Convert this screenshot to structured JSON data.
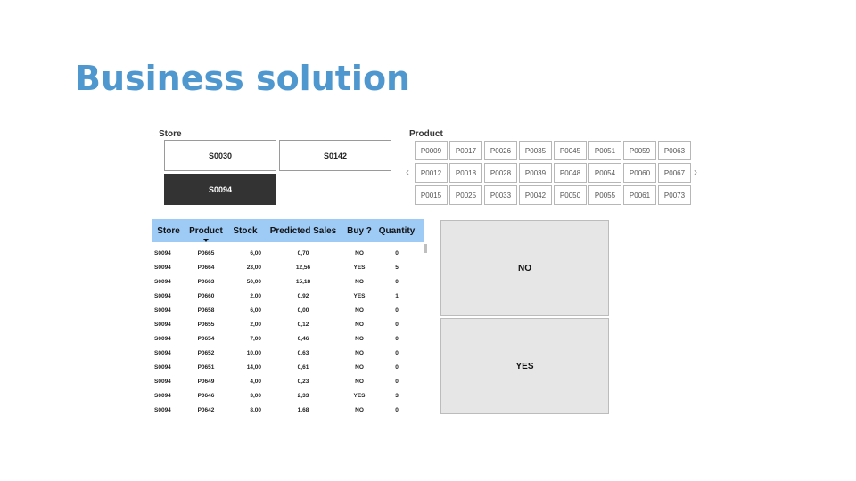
{
  "title": "Business solution",
  "store_slicer": {
    "label": "Store",
    "options": [
      "S0030",
      "S0142",
      "S0094"
    ],
    "selected": "S0094"
  },
  "product_slicer": {
    "label": "Product",
    "options": [
      "P0009",
      "P0017",
      "P0026",
      "P0035",
      "P0045",
      "P0051",
      "P0059",
      "P0063",
      "P0012",
      "P0018",
      "P0028",
      "P0039",
      "P0048",
      "P0054",
      "P0060",
      "P0067",
      "P0015",
      "P0025",
      "P0033",
      "P0042",
      "P0050",
      "P0055",
      "P0061",
      "P0073"
    ],
    "prev_icon": "chevron-left-icon",
    "next_icon": "chevron-right-icon"
  },
  "table": {
    "headers": [
      "Store",
      "Product",
      "Stock",
      "Predicted Sales",
      "Buy ?",
      "Quantity"
    ],
    "sorted_column": "Product",
    "rows": [
      [
        "S0094",
        "P0665",
        "6,00",
        "0,70",
        "NO",
        "0"
      ],
      [
        "S0094",
        "P0664",
        "23,00",
        "12,56",
        "YES",
        "5"
      ],
      [
        "S0094",
        "P0663",
        "50,00",
        "15,18",
        "NO",
        "0"
      ],
      [
        "S0094",
        "P0660",
        "2,00",
        "0,92",
        "YES",
        "1"
      ],
      [
        "S0094",
        "P0658",
        "6,00",
        "0,00",
        "NO",
        "0"
      ],
      [
        "S0094",
        "P0655",
        "2,00",
        "0,12",
        "NO",
        "0"
      ],
      [
        "S0094",
        "P0654",
        "7,00",
        "0,46",
        "NO",
        "0"
      ],
      [
        "S0094",
        "P0652",
        "10,00",
        "0,63",
        "NO",
        "0"
      ],
      [
        "S0094",
        "P0651",
        "14,00",
        "0,61",
        "NO",
        "0"
      ],
      [
        "S0094",
        "P0649",
        "4,00",
        "0,23",
        "NO",
        "0"
      ],
      [
        "S0094",
        "P0646",
        "3,00",
        "2,33",
        "YES",
        "3"
      ],
      [
        "S0094",
        "P0642",
        "8,00",
        "1,68",
        "NO",
        "0"
      ]
    ]
  },
  "cards": {
    "no": "NO",
    "yes": "YES"
  }
}
